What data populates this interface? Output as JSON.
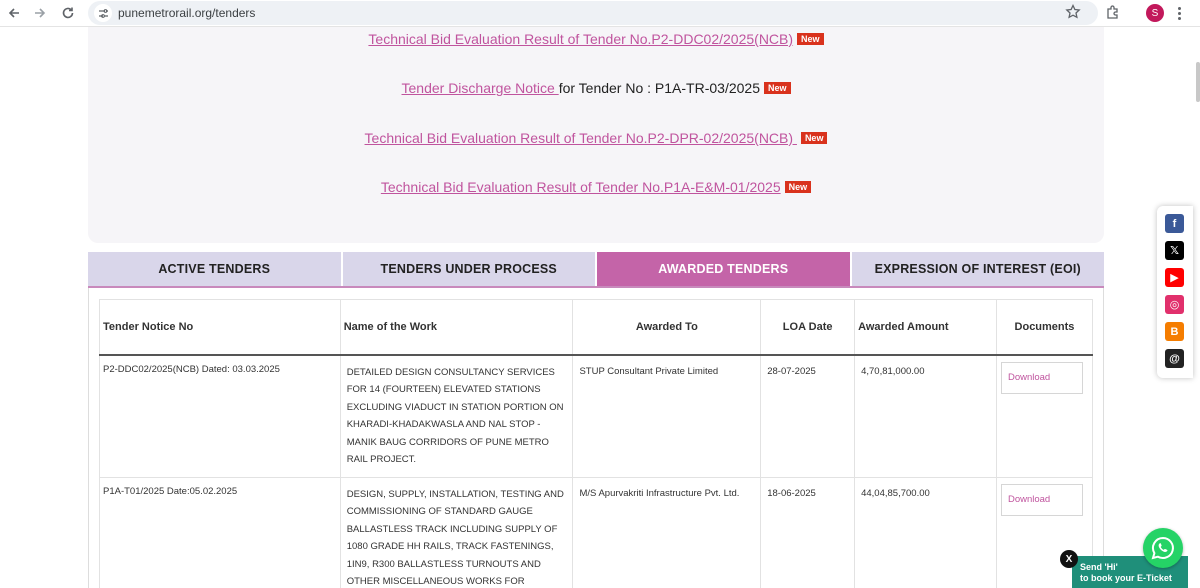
{
  "browser": {
    "url": "punemetrorail.org/tenders",
    "profile_initial": "S"
  },
  "notices": [
    {
      "link": "Technical Bid Evaluation Result of Tender No.P2-DDC02/2025(NCB)",
      "suffix": "",
      "badge": "New"
    },
    {
      "link": "Tender Discharge Notice ",
      "suffix": "for Tender No : P1A-TR-03/2025",
      "badge": "New"
    },
    {
      "link": "Technical Bid Evaluation Result of Tender No.P2-DPR-02/2025(NCB) ",
      "suffix": "",
      "badge": "New"
    },
    {
      "link": "Technical Bid Evaluation Result of Tender No.P1A-E&M-01/2025",
      "suffix": "",
      "badge": "New"
    }
  ],
  "tabs": [
    {
      "label": "ACTIVE TENDERS",
      "active": false
    },
    {
      "label": "TENDERS UNDER PROCESS",
      "active": false
    },
    {
      "label": "AWARDED TENDERS",
      "active": true
    },
    {
      "label": "EXPRESSION OF INTEREST (EOI)",
      "active": false
    }
  ],
  "table": {
    "headers": [
      "Tender Notice No",
      "Name of the Work",
      "Awarded To",
      "LOA Date",
      "Awarded Amount",
      "Documents"
    ],
    "rows": [
      {
        "notice": "P2-DDC02/2025(NCB) Dated: 03.03.2025",
        "work": "DETAILED DESIGN CONSULTANCY SERVICES FOR 14 (FOURTEEN) ELEVATED STATIONS EXCLUDING VIADUCT IN STATION PORTION ON KHARADI-KHADAKWASLA AND NAL STOP - MANIK BAUG CORRIDORS OF PUNE METRO RAIL PROJECT.",
        "awarded_to": "STUP Consultant Private Limited",
        "loa_date": "28-07-2025",
        "amount": "4,70,81,000.00",
        "document": "Download"
      },
      {
        "notice": "P1A-T01/2025 Date:05.02.2025",
        "work": "DESIGN, SUPPLY, INSTALLATION, TESTING AND COMMISSIONING OF STANDARD GAUGE BALLASTLESS TRACK INCLUDING SUPPLY OF 1080 GRADE HH RAILS, TRACK FASTENINGS, 1IN9, R300 BALLASTLESS TURNOUTS AND OTHER MISCELLANEOUS WORKS FOR",
        "awarded_to": "M/S Apurvakriti Infrastructure Pvt. Ltd.",
        "loa_date": "18-06-2025",
        "amount": "44,04,85,700.00",
        "document": "Download"
      }
    ]
  },
  "social": [
    {
      "name": "facebook",
      "glyph": "f",
      "color": "#3b5998"
    },
    {
      "name": "x",
      "glyph": "𝕏",
      "color": "#000000"
    },
    {
      "name": "youtube",
      "glyph": "▶",
      "color": "#ff0000"
    },
    {
      "name": "instagram",
      "glyph": "◎",
      "color": "#e1306c"
    },
    {
      "name": "blogger",
      "glyph": "B",
      "color": "#f57d00"
    },
    {
      "name": "threads",
      "glyph": "@",
      "color": "#222222"
    }
  ],
  "whatsapp": {
    "close": "X",
    "line1": "Send 'Hi'",
    "line2": "to book your E-Ticket"
  }
}
